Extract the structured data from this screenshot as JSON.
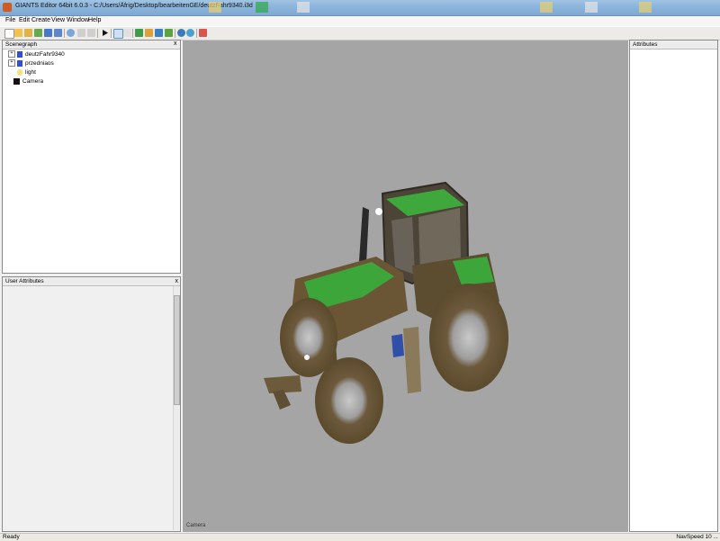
{
  "window": {
    "title": "GIANTS Editor 64bit 6.0.3 - C:/Users/Äfrig/Desktop/bearbeitenGE/deutzFahr9340.i3d"
  },
  "menu": [
    "File",
    "Edit",
    "Create",
    "View",
    "Window",
    "Help"
  ],
  "scenegraph": {
    "title": "Scenegraph",
    "close": "x",
    "items": [
      {
        "label": "deutzFahr9340",
        "expandable": true,
        "icon": "transform-cube-icon"
      },
      {
        "label": "przedniaos",
        "expandable": true,
        "icon": "transform-cube-icon"
      },
      {
        "label": "light",
        "expandable": false,
        "icon": "light-bulb-icon"
      },
      {
        "label": "Camera",
        "expandable": false,
        "icon": "camera-icon"
      }
    ]
  },
  "user_attributes": {
    "title": "User Attributes",
    "close": "x"
  },
  "attributes": {
    "title": "Attributes"
  },
  "viewport": {
    "camera_label": "Camera"
  },
  "status": {
    "left": "Ready",
    "right": "NavSpeed 10 ..."
  }
}
